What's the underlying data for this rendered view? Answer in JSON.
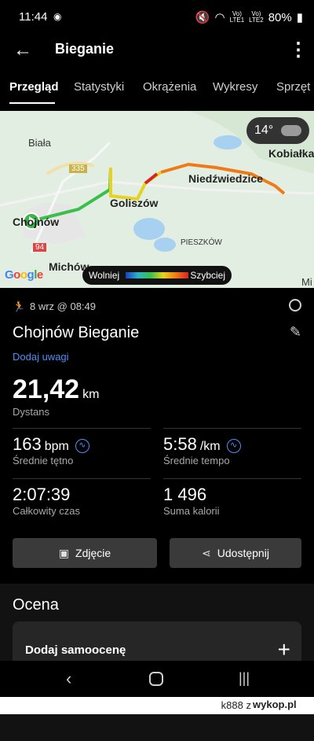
{
  "status_bar": {
    "time": "11:44",
    "sim1": "LTE1",
    "sim2": "LTE2",
    "battery": "80%"
  },
  "app_bar": {
    "title": "Bieganie"
  },
  "tabs": [
    {
      "label": "Przegląd",
      "active": true
    },
    {
      "label": "Statystyki",
      "active": false
    },
    {
      "label": "Okrążenia",
      "active": false
    },
    {
      "label": "Wykresy",
      "active": false
    },
    {
      "label": "Sprzęt",
      "active": false
    }
  ],
  "map": {
    "places": [
      "Biała",
      "Chojnów",
      "Goliszów",
      "Niedźwiedzice",
      "Kobiałka",
      "Michów",
      "PIESZKÓW",
      "Mi"
    ],
    "road_numbers": [
      "335",
      "94"
    ],
    "weather": "14°",
    "legend_slow": "Wolniej",
    "legend_fast": "Szybciej",
    "provider": "Google",
    "colors": {
      "start": "#3ab54a",
      "route_fast": "#d92323",
      "route_mid": "#e6d21f",
      "route_slow": "#3ac04a"
    }
  },
  "activity": {
    "date": "8 wrz @ 08:49",
    "title": "Chojnów Bieganie",
    "add_note": "Dodaj uwagi",
    "distance": {
      "value": "21,42",
      "unit": "km",
      "label": "Dystans"
    },
    "heart_rate": {
      "value": "163",
      "unit": "bpm",
      "label": "Średnie tętno"
    },
    "pace": {
      "value": "5:58",
      "unit": "/km",
      "label": "Średnie tempo"
    },
    "total_time": {
      "value": "2:07:39",
      "label": "Całkowity czas"
    },
    "calories": {
      "value": "1 496",
      "label": "Suma kalorii"
    }
  },
  "buttons": {
    "photo": "Zdjęcie",
    "share": "Udostępnij"
  },
  "rating": {
    "title": "Ocena",
    "self_rating": "Dodaj samoocenę"
  },
  "footer": {
    "user": "k888",
    "sep": "z",
    "site": "wykop.pl"
  }
}
